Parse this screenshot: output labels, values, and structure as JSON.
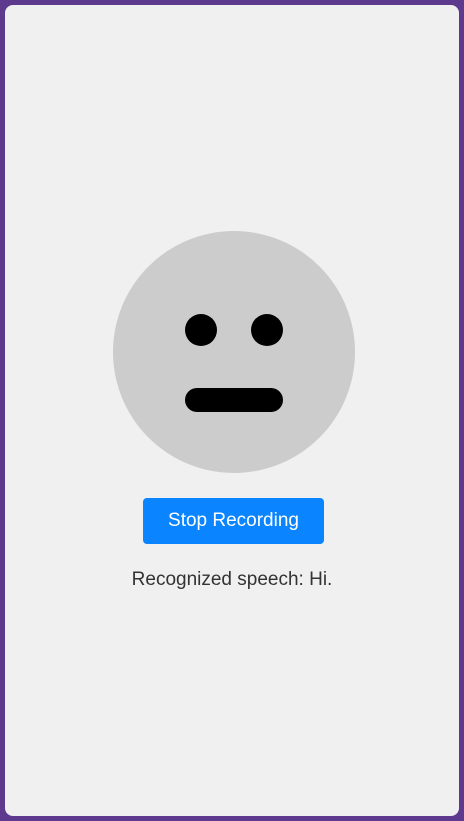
{
  "face": {
    "expression": "neutral",
    "face_color": "#cccccc",
    "feature_color": "#000000"
  },
  "controls": {
    "record_button_label": "Stop Recording",
    "record_button_color": "#0a84ff"
  },
  "speech": {
    "prefix": "Recognized speech:",
    "value": "Hi."
  },
  "colors": {
    "border": "#5e3a8f",
    "background": "#f0f0f0",
    "text": "#333333"
  }
}
